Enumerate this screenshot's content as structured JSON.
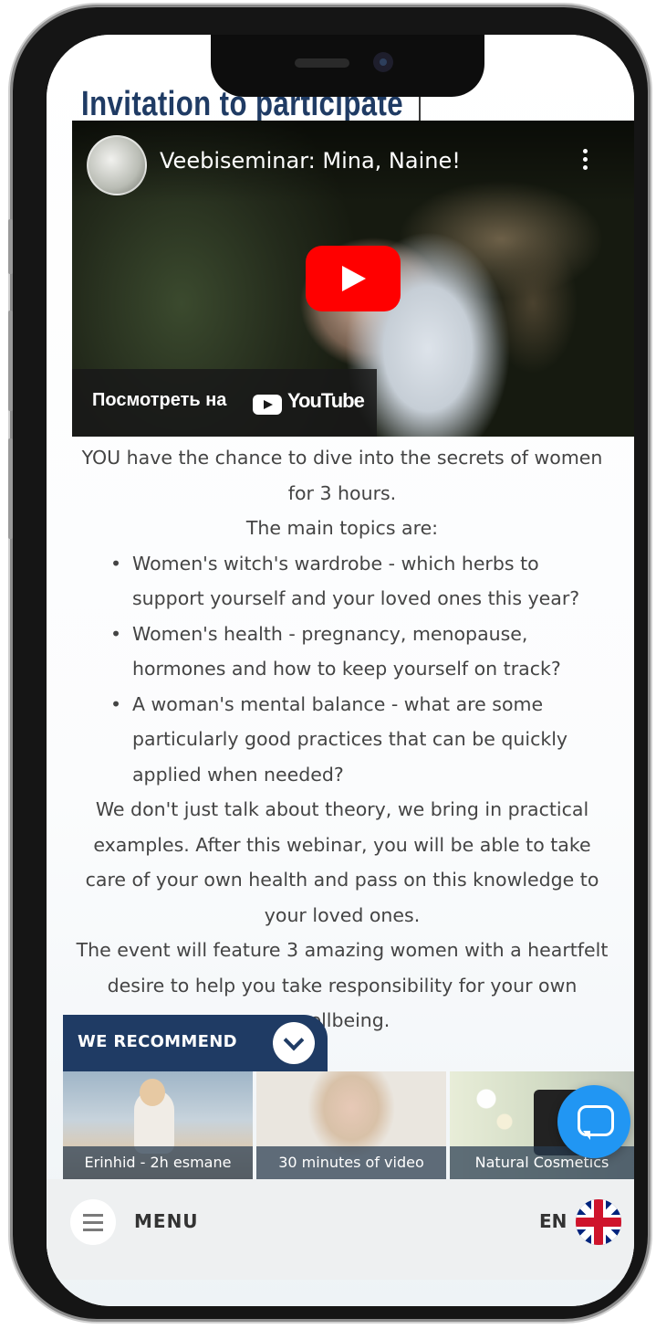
{
  "page": {
    "heading": "Invitation to participate"
  },
  "video": {
    "title": "Veebiseminar: Mina, Naine!",
    "watch_on": "Посмотреть на",
    "youtube_word": "YouTube"
  },
  "article": {
    "intro_line": "YOU have the chance to dive into the secrets of women for 3 hours.",
    "topics_heading": "The main topics are:",
    "topics": [
      "Women's witch's wardrobe - which herbs to support yourself and your loved ones this year?",
      "Women's health - pregnancy, menopause, hormones and how to keep yourself on track?",
      "A woman's mental balance - what are some particularly good practices that can be quickly applied when needed?"
    ],
    "paragraph_1": "We don't just talk about theory, we bring in practical examples. After this webinar, you will be able to take care of your own health and pass on this knowledge to your loved ones.",
    "paragraph_2": "The event will feature 3 amazing women with a heartfelt desire to help you take responsibility for your own wellbeing."
  },
  "recommend": {
    "label": "WE RECOMMEND",
    "cards": [
      {
        "caption": "Erinhid - 2h esmane"
      },
      {
        "caption": "30 minutes of video"
      },
      {
        "caption": "Natural Cosmetics"
      }
    ]
  },
  "bottom_nav": {
    "menu_label": "MENU",
    "language": "EN"
  },
  "colors": {
    "heading": "#1f3b64",
    "recommend_bg": "#1f3b64",
    "chat_button": "#2196f3",
    "play_button": "#ff0000"
  },
  "icons": [
    "play-icon",
    "kebab-icon",
    "youtube-icon",
    "chevron-down-icon",
    "chat-icon",
    "hamburger-icon",
    "uk-flag-icon"
  ]
}
